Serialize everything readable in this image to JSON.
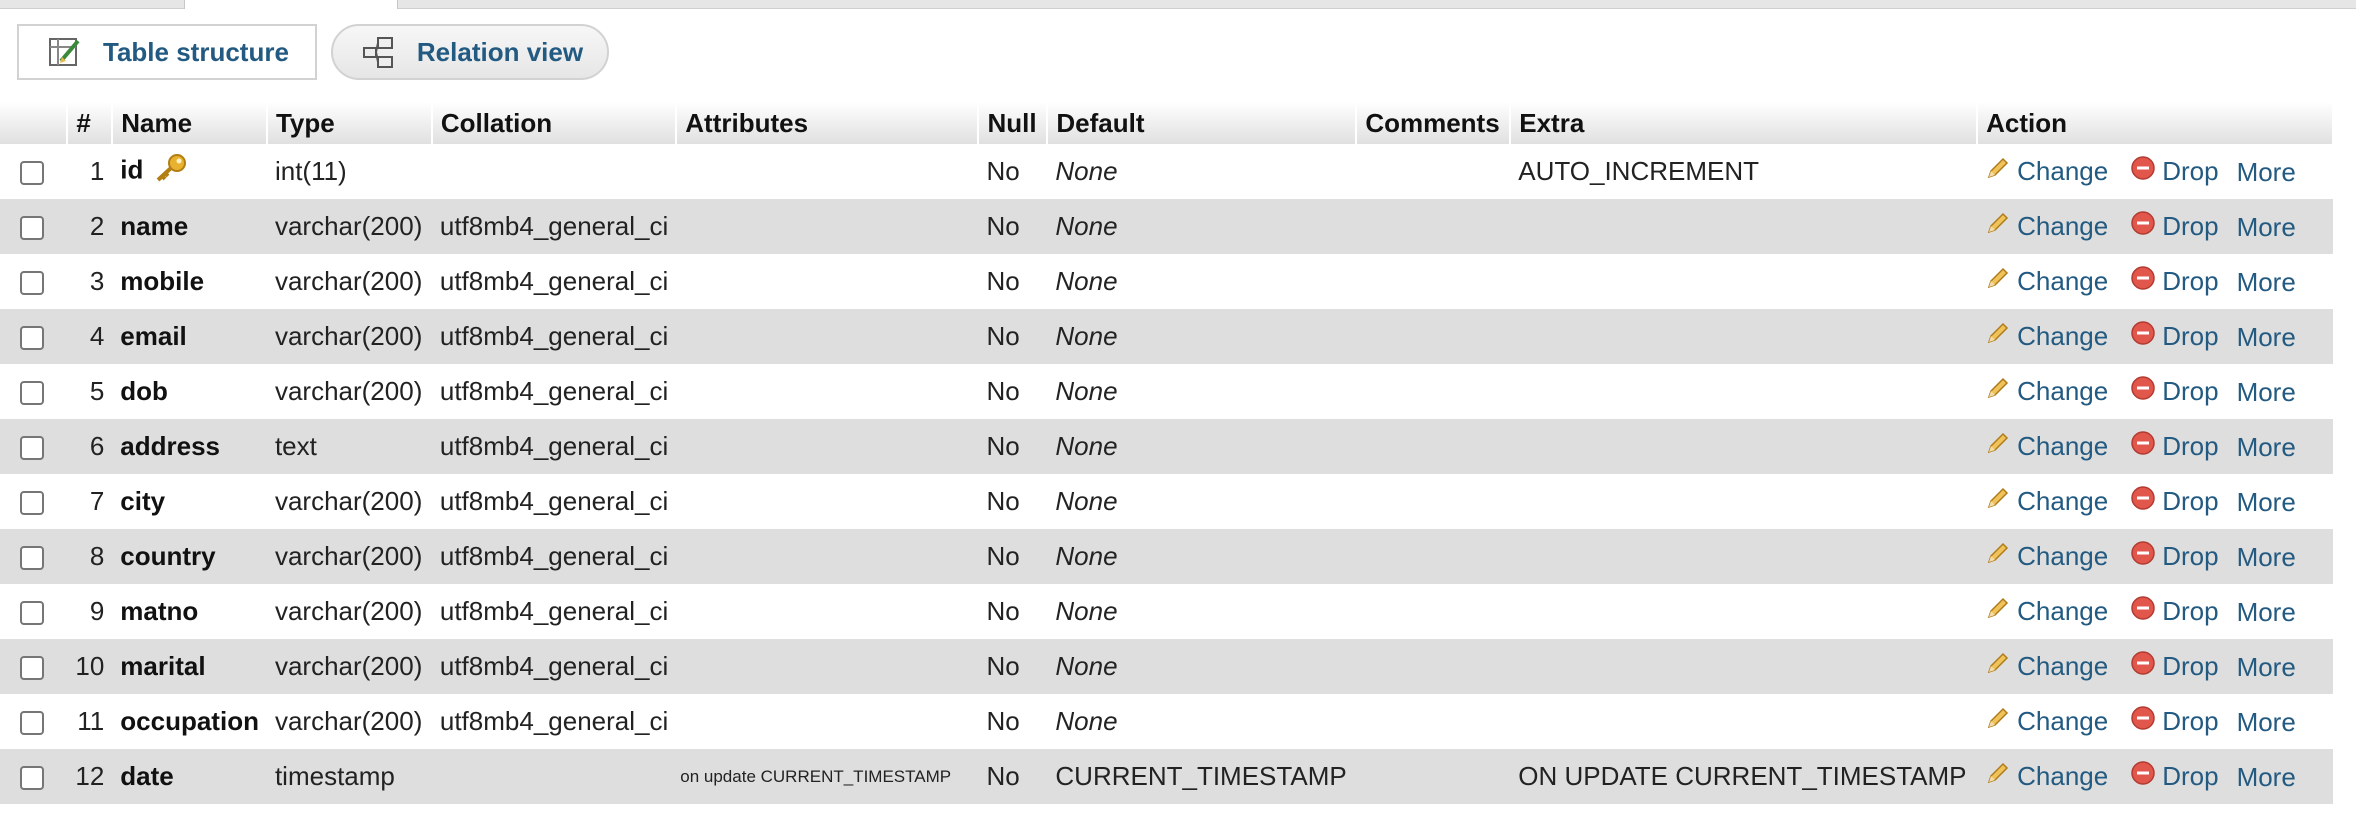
{
  "view_buttons": {
    "table_structure": "Table structure",
    "relation_view": "Relation view"
  },
  "columns_header": [
    "#",
    "Name",
    "Type",
    "Collation",
    "Attributes",
    "Null",
    "Default",
    "Comments",
    "Extra",
    "Action"
  ],
  "actions": {
    "change": "Change",
    "drop": "Drop",
    "more": "More"
  },
  "rows": [
    {
      "num": "1",
      "name": "id",
      "primary_key": true,
      "type": "int(11)",
      "collation": "",
      "attributes": "",
      "null": "No",
      "default": "None",
      "comments": "",
      "extra": "AUTO_INCREMENT"
    },
    {
      "num": "2",
      "name": "name",
      "type": "varchar(200)",
      "collation": "utf8mb4_general_ci",
      "attributes": "",
      "null": "No",
      "default": "None",
      "comments": "",
      "extra": ""
    },
    {
      "num": "3",
      "name": "mobile",
      "type": "varchar(200)",
      "collation": "utf8mb4_general_ci",
      "attributes": "",
      "null": "No",
      "default": "None",
      "comments": "",
      "extra": ""
    },
    {
      "num": "4",
      "name": "email",
      "type": "varchar(200)",
      "collation": "utf8mb4_general_ci",
      "attributes": "",
      "null": "No",
      "default": "None",
      "comments": "",
      "extra": ""
    },
    {
      "num": "5",
      "name": "dob",
      "type": "varchar(200)",
      "collation": "utf8mb4_general_ci",
      "attributes": "",
      "null": "No",
      "default": "None",
      "comments": "",
      "extra": ""
    },
    {
      "num": "6",
      "name": "address",
      "type": "text",
      "collation": "utf8mb4_general_ci",
      "attributes": "",
      "null": "No",
      "default": "None",
      "comments": "",
      "extra": ""
    },
    {
      "num": "7",
      "name": "city",
      "type": "varchar(200)",
      "collation": "utf8mb4_general_ci",
      "attributes": "",
      "null": "No",
      "default": "None",
      "comments": "",
      "extra": ""
    },
    {
      "num": "8",
      "name": "country",
      "type": "varchar(200)",
      "collation": "utf8mb4_general_ci",
      "attributes": "",
      "null": "No",
      "default": "None",
      "comments": "",
      "extra": ""
    },
    {
      "num": "9",
      "name": "matno",
      "type": "varchar(200)",
      "collation": "utf8mb4_general_ci",
      "attributes": "",
      "null": "No",
      "default": "None",
      "comments": "",
      "extra": ""
    },
    {
      "num": "10",
      "name": "marital",
      "type": "varchar(200)",
      "collation": "utf8mb4_general_ci",
      "attributes": "",
      "null": "No",
      "default": "None",
      "comments": "",
      "extra": ""
    },
    {
      "num": "11",
      "name": "occupation",
      "type": "varchar(200)",
      "collation": "utf8mb4_general_ci",
      "attributes": "",
      "null": "No",
      "default": "None",
      "comments": "",
      "extra": ""
    },
    {
      "num": "12",
      "name": "date",
      "type": "timestamp",
      "collation": "",
      "attributes": "on update CURRENT_TIMESTAMP",
      "null": "No",
      "default": "CURRENT_TIMESTAMP",
      "comments": "",
      "extra": "ON UPDATE CURRENT_TIMESTAMP"
    }
  ],
  "icons": {
    "table_structure": "table-structure-icon",
    "relation_view": "relation-view-icon",
    "primary_key": "key-icon",
    "change": "pencil-icon",
    "drop": "drop-circle-icon"
  },
  "colors": {
    "link": "#235a81",
    "drop_icon": "#d9534f",
    "key": "#e0a82e",
    "row_alt": "#dedede"
  }
}
